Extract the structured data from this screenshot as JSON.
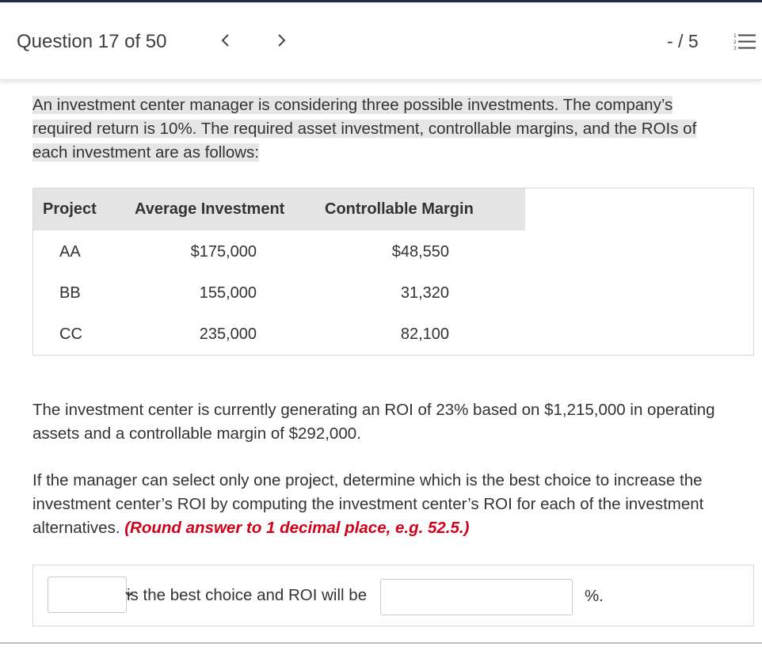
{
  "header": {
    "question_label": "Question 17 of 50",
    "score": "- / 5",
    "icons": {
      "prev": "chevron-left-icon",
      "next": "chevron-right-icon",
      "list": "numbered-list-icon"
    }
  },
  "problem": {
    "intro": "An investment center manager is considering three possible investments. The company’s required return is 10%. The required asset investment, controllable margins, and the ROIs of each investment are as follows:",
    "table": {
      "columns": [
        "Project",
        "Average Investment",
        "Controllable Margin"
      ],
      "rows": [
        {
          "project": "AA",
          "investment": "$175,000",
          "margin": "$48,550"
        },
        {
          "project": "BB",
          "investment": "155,000",
          "margin": "31,320"
        },
        {
          "project": "CC",
          "investment": "235,000",
          "margin": "82,100"
        }
      ]
    },
    "current_status": "The investment center is currently generating an ROI of 23% based on $1,215,000 in operating assets and a controllable margin of $292,000.",
    "instruction": "If the manager can select only one project, determine which is the best choice to increase the investment center’s ROI by computing the investment center’s ROI for each of the investment alternatives.",
    "round_note": "(Round answer to 1 decimal place, e.g. 52.5.)"
  },
  "answer": {
    "project_select_value": "",
    "middle_text": "is the best choice and ROI will be",
    "roi_value": "",
    "suffix": "%."
  },
  "colors": {
    "top_rule": "#1f2a44",
    "table_header_bg": "#e4e4e4",
    "highlight_bg": "#e6e6e6",
    "round_note": "#d0021b"
  }
}
